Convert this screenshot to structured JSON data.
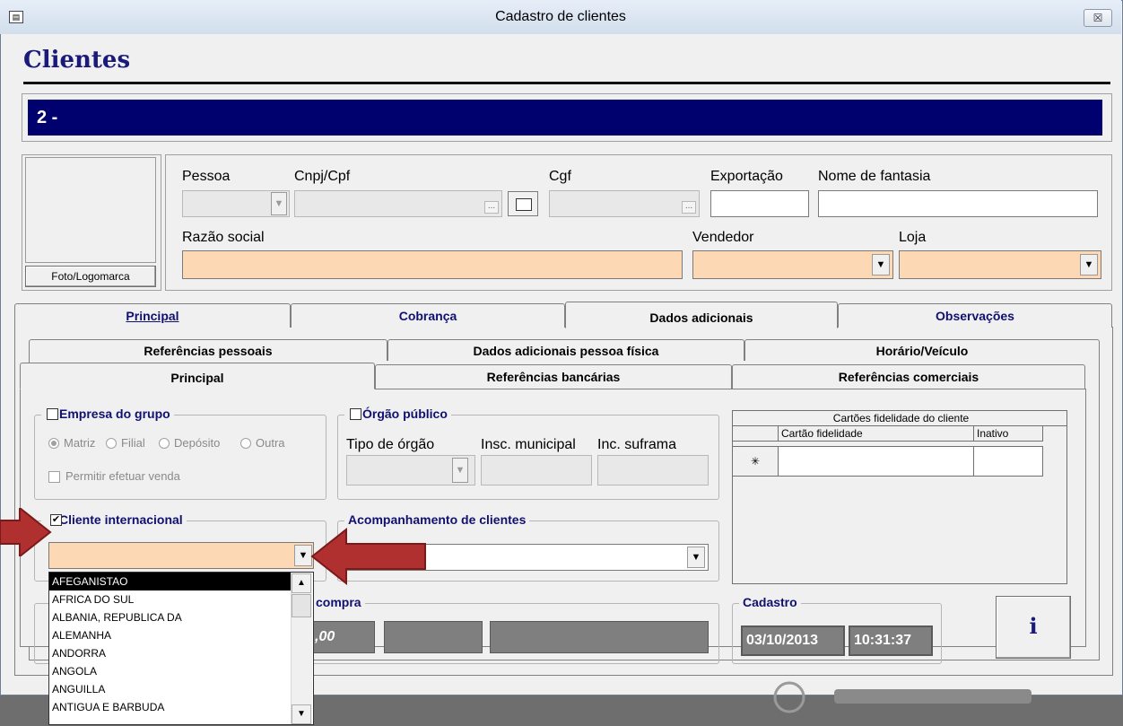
{
  "window": {
    "title": "Cadastro de clientes",
    "close_label": "☒"
  },
  "header": {
    "title": "Clientes",
    "record_id": "2 -"
  },
  "photo": {
    "button_label": "Foto/Logomarca"
  },
  "fields": {
    "pessoa": "Pessoa",
    "cnpj": "Cnpj/Cpf",
    "cgf": "Cgf",
    "exportacao": "Exportação",
    "nome_fantasia": "Nome de fantasia",
    "razao_social": "Razão social",
    "vendedor": "Vendedor",
    "loja": "Loja",
    "ellipsis": "..."
  },
  "tabs_main": [
    "Principal",
    "Cobrança",
    "Dados adicionais",
    "Observações"
  ],
  "tabs_sub_row1": [
    "Referências pessoais",
    "Dados adicionais pessoa física",
    "Horário/Veículo"
  ],
  "tabs_sub_row2": [
    "Principal",
    "Referências bancárias",
    "Referências comerciais"
  ],
  "empresa_grupo": {
    "title": "Empresa do grupo",
    "radios": [
      "Matriz",
      "Filial",
      "Depósito",
      "Outra"
    ],
    "permitir": "Permitir efetuar venda"
  },
  "orgao_publico": {
    "title": "Órgão público",
    "tipo": "Tipo de órgão",
    "insc_municipal": "Insc. municipal",
    "inc_suframa": "Inc. suframa"
  },
  "cartoes": {
    "title": "Cartões fidelidade do cliente",
    "col1": "Cartão fidelidade",
    "col2": "Inativo",
    "new_row_marker": "✳"
  },
  "cliente_internacional": {
    "title": "Cliente internacional",
    "checked_mark": "✔"
  },
  "acompanhamento": {
    "title": "Acompanhamento de clientes"
  },
  "compra": {
    "title": "compra",
    "value": ",00"
  },
  "cadastro": {
    "title": "Cadastro",
    "date": "03/10/2013",
    "time": "10:31:37"
  },
  "info_button": {
    "label": "i"
  },
  "country_list": [
    "AFEGANISTAO",
    "AFRICA DO SUL",
    "ALBANIA, REPUBLICA DA",
    "ALEMANHA",
    "ANDORRA",
    "ANGOLA",
    "ANGUILLA",
    "ANTIGUA E BARBUDA"
  ],
  "colors": {
    "accent_navy": "#00006e",
    "required_field": "#fdd8b5",
    "arrow": "#b03030"
  }
}
